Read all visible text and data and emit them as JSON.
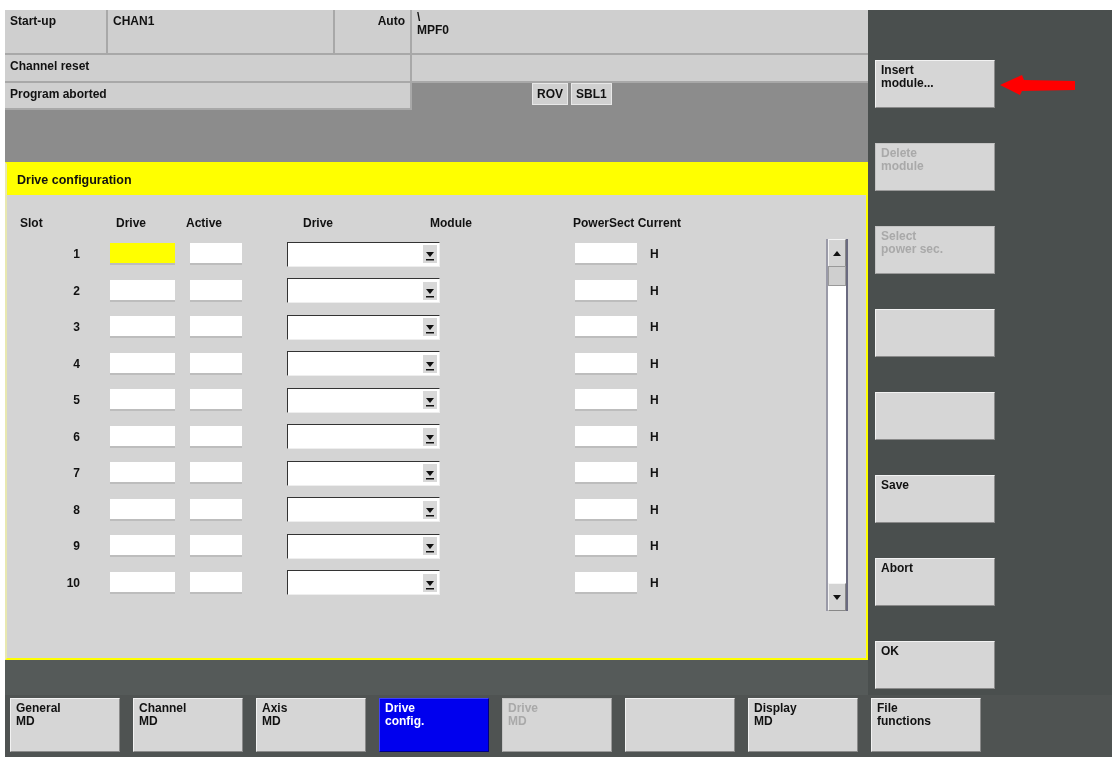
{
  "status": {
    "mode_group": "Start-up",
    "channel": "CHAN1",
    "operating_mode": "Auto",
    "program_path": "\\",
    "program_name": "MPF0",
    "channel_status": "Channel reset",
    "program_status": "Program aborted",
    "indicators": [
      "ROV",
      "SBL1"
    ]
  },
  "dialog": {
    "title": "Drive configuration",
    "columns": [
      "Slot",
      "Drive",
      "Active",
      "Drive",
      "Module",
      "PowerSect Current"
    ],
    "rows": [
      {
        "slot": "1",
        "focused": true,
        "unit": "H"
      },
      {
        "slot": "2",
        "focused": false,
        "unit": "H"
      },
      {
        "slot": "3",
        "focused": false,
        "unit": "H"
      },
      {
        "slot": "4",
        "focused": false,
        "unit": "H"
      },
      {
        "slot": "5",
        "focused": false,
        "unit": "H"
      },
      {
        "slot": "6",
        "focused": false,
        "unit": "H"
      },
      {
        "slot": "7",
        "focused": false,
        "unit": "H"
      },
      {
        "slot": "8",
        "focused": false,
        "unit": "H"
      },
      {
        "slot": "9",
        "focused": false,
        "unit": "H"
      },
      {
        "slot": "10",
        "focused": false,
        "unit": "H"
      }
    ]
  },
  "vertical_softkeys": [
    {
      "label": "Insert\nmodule...",
      "disabled": false
    },
    {
      "label": "Delete\nmodule",
      "disabled": true
    },
    {
      "label": "Select\npower sec.",
      "disabled": true
    },
    {
      "disabled": false
    },
    {
      "disabled": false
    },
    {
      "label": "Save",
      "disabled": false
    },
    {
      "label": "Abort",
      "disabled": false
    },
    {
      "label": "OK",
      "disabled": false
    }
  ],
  "horizontal_softkeys": [
    {
      "label": "General\nMD",
      "selected": false,
      "disabled": false
    },
    {
      "label": "Channel\nMD",
      "selected": false,
      "disabled": false
    },
    {
      "label": "Axis\nMD",
      "selected": false,
      "disabled": false
    },
    {
      "label": "Drive\nconfig.",
      "selected": true,
      "disabled": false
    },
    {
      "label": "Drive\nMD",
      "selected": false,
      "disabled": true
    },
    {
      "selected": false,
      "disabled": false
    },
    {
      "label": "Display\nMD",
      "selected": false,
      "disabled": false
    },
    {
      "label": "File\nfunctions",
      "selected": false,
      "disabled": false
    }
  ]
}
